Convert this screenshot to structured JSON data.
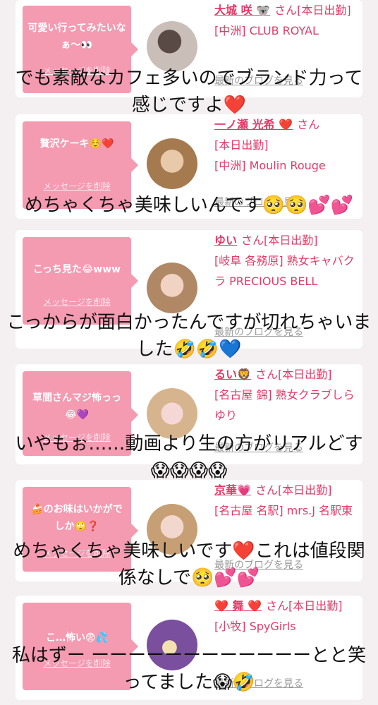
{
  "cards": [
    {
      "message": "可愛い行ってみたいなぁ〜👀",
      "delete": "メッセージを削除",
      "name": "大城 咲 🐨",
      "suffix": "さん[本日出勤]",
      "shop": "[中洲] CLUB ROYAL",
      "blog": "最新のブログを見る"
    },
    {
      "message": "贅沢ケーキ☺️❤️",
      "delete": "メッセージを削除",
      "name": "一ノ瀬 光希 ❤️",
      "suffix": "さん",
      "status": "[本日出勤]",
      "shop": "[中洲] Moulin Rouge",
      "blog": "最新のブログを見る"
    },
    {
      "message": "こっち見た😂www",
      "delete": "メッセージを削除",
      "name": "ゆい",
      "suffix": "さん[本日出勤]",
      "shop": "[岐阜 各務原] 熟女キャバクラ PRECIOUS BELL",
      "blog": "最新のブログを見る"
    },
    {
      "message": "草間さんマジ怖っっ😂💜",
      "delete": "メッセージを削除",
      "name": "るい🦁",
      "suffix": "さん[本日出勤]",
      "shop": "[名古屋 錦] 熟女クラブしらゆり",
      "blog": "最新のブログを見る"
    },
    {
      "message": "🍰のお味はいかがでしか🙄❓",
      "delete": "メッセージを削除",
      "name": "京華💗",
      "suffix": "さん[本日出勤]",
      "shop": "[名古屋 名駅] mrs.J 名駅東",
      "blog": "最新のブログを見る"
    },
    {
      "message": "こ…怖い😨💦",
      "delete": "メッセージを削除",
      "name": "❤️ 舞 ❤️",
      "suffix": "さん[本日出勤]",
      "shop": "[小牧] SpyGirls",
      "blog": "最新のブログを見る"
    }
  ],
  "overlays": [
    "でも素敵なカフェ多いのでブランド力って感じですよ❤️",
    "めちゃくちゃ美味しいんです🥺🥺💕💕",
    "こっからが面白かったんですが切れちゃいました🤣🤣💙",
    "いやもぉ……動画より生の方がリアルどす😱😱😱😱",
    "めちゃくちゃ美味しいです❤️これは値段関係なしで🥺💕💕",
    "私はずー ーーーーーーーーーーーーとと笑ってました😱🤣"
  ],
  "colors": {
    "accent": "#e13a67",
    "bubble": "#f49ab1",
    "background": "#f4f0f1"
  }
}
